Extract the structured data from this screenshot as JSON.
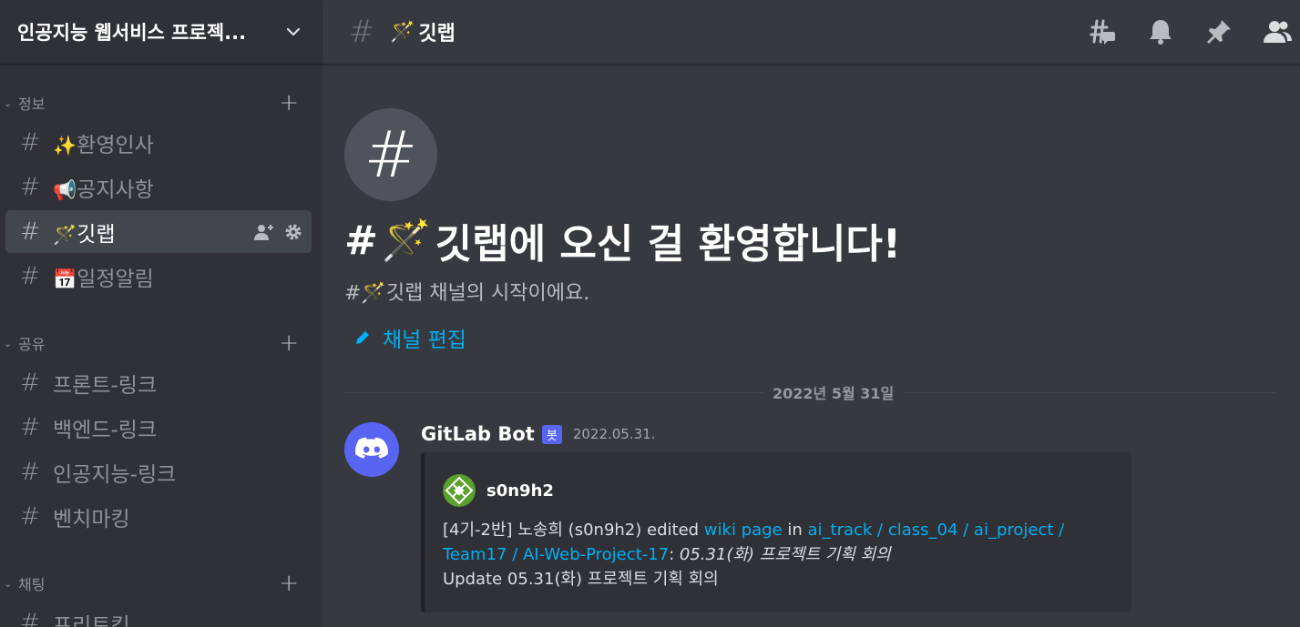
{
  "server": {
    "name": "인공지능 웹서비스 프로젝..."
  },
  "categories": [
    {
      "name": "정보"
    },
    {
      "name": "공유"
    },
    {
      "name": "채팅"
    }
  ],
  "channels": {
    "info": [
      {
        "emoji": "✨",
        "label": "환영인사"
      },
      {
        "emoji": "📢",
        "label": "공지사항"
      },
      {
        "emoji": "🪄",
        "label": "깃랩"
      },
      {
        "emoji": "📅",
        "label": "일정알림"
      }
    ],
    "share": [
      {
        "label": "프론트-링크"
      },
      {
        "label": "백엔드-링크"
      },
      {
        "label": "인공지능-링크"
      },
      {
        "label": "벤치마킹"
      }
    ],
    "chat": [
      {
        "label": "프리토킹"
      }
    ]
  },
  "topbar": {
    "emoji": "🪄",
    "title": "깃랩"
  },
  "welcome": {
    "hash": "#",
    "title_prefix": "#",
    "emoji": "🪄",
    "title_suffix": "깃랩에 오신 걸 환영합니다!",
    "subtitle": "#🪄깃랩 채널의 시작이에요.",
    "edit_label": "채널 편집"
  },
  "date_divider": "2022년 5월 31일",
  "message": {
    "author": "GitLab Bot",
    "bot_tag": "봇",
    "timestamp": "2022.05.31.",
    "embed": {
      "author_name": "s0n9h2",
      "text_1": "[4기-2반] 노송희 (s0n9h2) edited ",
      "link_1": "wiki page",
      "text_2": " in ",
      "link_2": "ai_track / class_04 / ai_project / Team17 / AI-Web-Project-17",
      "text_3": ": ",
      "italic": "05.31(화) 프로젝트 기획 회의",
      "line_2": "Update 05.31(화) 프로젝트 기획 회의"
    }
  },
  "colors": {
    "accent": "#5865f2",
    "link": "#00aff4",
    "sidebar_bg": "#2f3136",
    "main_bg": "#36393f"
  },
  "icons": [
    "chevron-down-icon",
    "threads-icon",
    "bell-icon",
    "pin-icon",
    "members-icon",
    "add-member-icon",
    "gear-icon",
    "pencil-icon",
    "discord-logo-icon"
  ]
}
